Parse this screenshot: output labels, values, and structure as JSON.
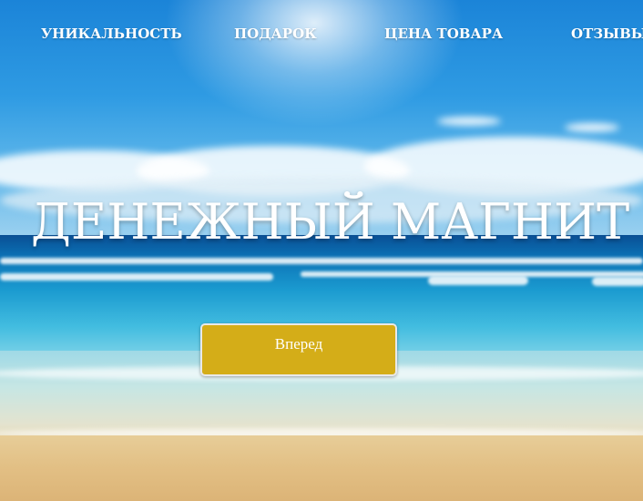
{
  "nav": {
    "items": [
      {
        "label": "УНИКАЛЬНОСТЬ"
      },
      {
        "label": "ПОДАРОК"
      },
      {
        "label": "ЦЕНА ТОВАРА"
      },
      {
        "label": "ОТЗЫВЫ"
      }
    ]
  },
  "hero": {
    "title": "ДЕНЕЖНЫЙ МАГНИТ",
    "button_label": "Вперед"
  },
  "colors": {
    "accent": "#d4ad18",
    "text": "#ffffff"
  }
}
